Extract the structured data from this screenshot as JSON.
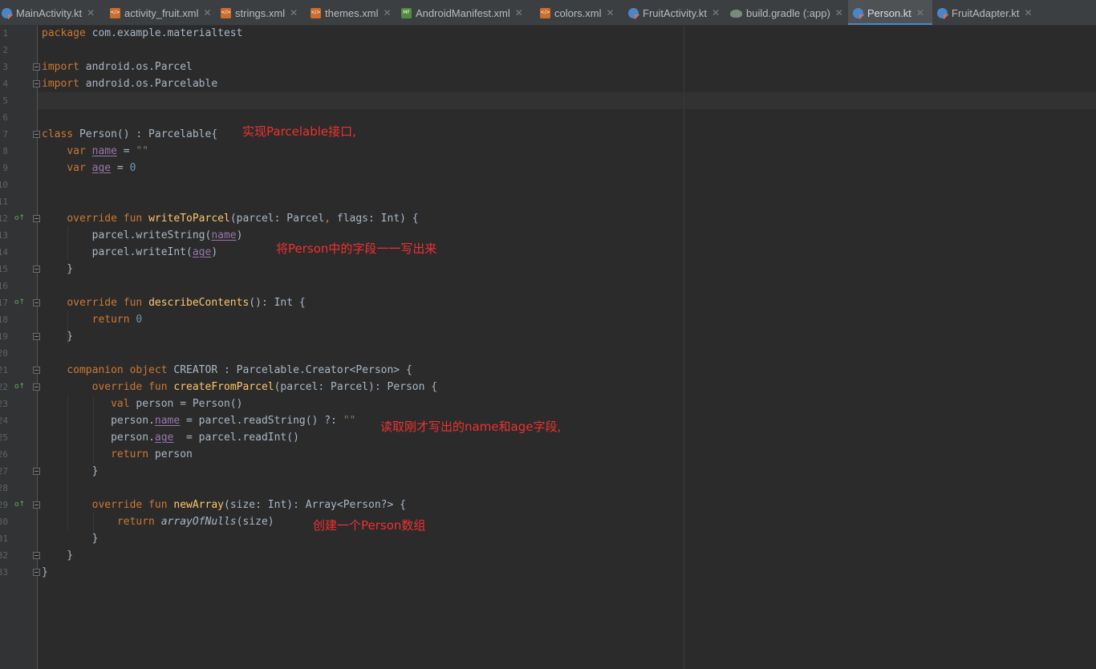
{
  "tabs": [
    {
      "label": "MainActivity.kt",
      "icon": "kotlin-file-icon",
      "active": false
    },
    {
      "label": "activity_fruit.xml",
      "icon": "xml-file-icon",
      "active": false
    },
    {
      "label": "strings.xml",
      "icon": "xml-file-icon",
      "active": false
    },
    {
      "label": "themes.xml",
      "icon": "xml-file-icon",
      "active": false
    },
    {
      "label": "AndroidManifest.xml",
      "icon": "manifest-file-icon",
      "active": false
    },
    {
      "label": "colors.xml",
      "icon": "xml-file-icon",
      "active": false
    },
    {
      "label": "FruitActivity.kt",
      "icon": "kotlin-file-icon",
      "active": false
    },
    {
      "label": "build.gradle (:app)",
      "icon": "gradle-file-icon",
      "active": false
    },
    {
      "label": "Person.kt",
      "icon": "kotlin-file-icon",
      "active": true
    },
    {
      "label": "FruitAdapter.kt",
      "icon": "kotlin-file-icon",
      "active": false
    }
  ],
  "tab_close_glyph": "✕",
  "gutter": {
    "line_numbers": [
      "1",
      "2",
      "3",
      "4",
      "5",
      "6",
      "7",
      "8",
      "9",
      "10",
      "11",
      "12",
      "13",
      "14",
      "15",
      "16",
      "17",
      "18",
      "19",
      "20",
      "21",
      "22",
      "23",
      "24",
      "25",
      "26",
      "27",
      "28",
      "29",
      "30",
      "31",
      "32",
      "33"
    ],
    "override_marker_lines": [
      12,
      17,
      22,
      29
    ],
    "override_glyph": "o↑",
    "override_icon": "override-method-icon",
    "fold_marker_lines": [
      3,
      4,
      7,
      12,
      15,
      17,
      19,
      21,
      22,
      27,
      29,
      32,
      33
    ]
  },
  "code": {
    "caret_line": 5,
    "lines": [
      {
        "n": 1,
        "tokens": [
          [
            "package",
            "kw"
          ],
          [
            " com.example.materialtest",
            ""
          ]
        ]
      },
      {
        "n": 2,
        "tokens": []
      },
      {
        "n": 3,
        "tokens": [
          [
            "import",
            "kw"
          ],
          [
            " android.os.Parcel",
            ""
          ]
        ]
      },
      {
        "n": 4,
        "tokens": [
          [
            "import",
            "kw"
          ],
          [
            " android.os.Parcelable",
            ""
          ]
        ]
      },
      {
        "n": 5,
        "tokens": []
      },
      {
        "n": 6,
        "tokens": []
      },
      {
        "n": 7,
        "tokens": [
          [
            "class",
            "kw"
          ],
          [
            " Person() : Parcelable{",
            ""
          ]
        ]
      },
      {
        "n": 8,
        "tokens": [
          [
            "    ",
            ""
          ],
          [
            "var",
            "kw"
          ],
          [
            " ",
            ""
          ],
          [
            "name",
            "prop"
          ],
          [
            " = ",
            ""
          ],
          [
            "\"\"",
            "str"
          ]
        ]
      },
      {
        "n": 9,
        "tokens": [
          [
            "    ",
            ""
          ],
          [
            "var",
            "kw"
          ],
          [
            " ",
            ""
          ],
          [
            "age",
            "prop"
          ],
          [
            " = ",
            ""
          ],
          [
            "0",
            "num"
          ]
        ]
      },
      {
        "n": 10,
        "tokens": []
      },
      {
        "n": 11,
        "tokens": []
      },
      {
        "n": 12,
        "tokens": [
          [
            "    ",
            ""
          ],
          [
            "override fun",
            "kw"
          ],
          [
            " ",
            ""
          ],
          [
            "writeToParcel",
            "fn"
          ],
          [
            "(parcel: Parcel",
            ""
          ],
          [
            ",",
            "kw"
          ],
          [
            " flags: Int) {",
            ""
          ]
        ]
      },
      {
        "n": 13,
        "tokens": [
          [
            "        parcel.writeString(",
            ""
          ],
          [
            "name",
            "prop"
          ],
          [
            ")",
            ""
          ]
        ]
      },
      {
        "n": 14,
        "tokens": [
          [
            "        parcel.writeInt(",
            ""
          ],
          [
            "age",
            "prop"
          ],
          [
            ")",
            ""
          ]
        ]
      },
      {
        "n": 15,
        "tokens": [
          [
            "    }",
            ""
          ]
        ]
      },
      {
        "n": 16,
        "tokens": []
      },
      {
        "n": 17,
        "tokens": [
          [
            "    ",
            ""
          ],
          [
            "override fun",
            "kw"
          ],
          [
            " ",
            ""
          ],
          [
            "describeContents",
            "fn"
          ],
          [
            "(): Int {",
            ""
          ]
        ]
      },
      {
        "n": 18,
        "tokens": [
          [
            "        ",
            ""
          ],
          [
            "return",
            "kw"
          ],
          [
            " ",
            ""
          ],
          [
            "0",
            "num"
          ]
        ]
      },
      {
        "n": 19,
        "tokens": [
          [
            "    }",
            ""
          ]
        ]
      },
      {
        "n": 20,
        "tokens": []
      },
      {
        "n": 21,
        "tokens": [
          [
            "    ",
            ""
          ],
          [
            "companion object",
            "kw"
          ],
          [
            " CREATOR : Parcelable.Creator<Person> {",
            ""
          ]
        ]
      },
      {
        "n": 22,
        "tokens": [
          [
            "        ",
            ""
          ],
          [
            "override fun",
            "kw"
          ],
          [
            " ",
            ""
          ],
          [
            "createFromParcel",
            "fn"
          ],
          [
            "(parcel: Parcel): Person {",
            ""
          ]
        ]
      },
      {
        "n": 23,
        "tokens": [
          [
            "           ",
            ""
          ],
          [
            "val",
            "kw"
          ],
          [
            " person = Person()",
            ""
          ]
        ]
      },
      {
        "n": 24,
        "tokens": [
          [
            "           person.",
            ""
          ],
          [
            "name",
            "prop"
          ],
          [
            " = parcel.readString() ?: ",
            ""
          ],
          [
            "\"\"",
            "str"
          ]
        ]
      },
      {
        "n": 25,
        "tokens": [
          [
            "           person.",
            ""
          ],
          [
            "age",
            "prop"
          ],
          [
            "  = parcel.readInt()",
            ""
          ]
        ]
      },
      {
        "n": 26,
        "tokens": [
          [
            "           ",
            ""
          ],
          [
            "return",
            "kw"
          ],
          [
            " person",
            ""
          ]
        ]
      },
      {
        "n": 27,
        "tokens": [
          [
            "        }",
            ""
          ]
        ]
      },
      {
        "n": 28,
        "tokens": []
      },
      {
        "n": 29,
        "tokens": [
          [
            "        ",
            ""
          ],
          [
            "override fun",
            "kw"
          ],
          [
            " ",
            ""
          ],
          [
            "newArray",
            "fn"
          ],
          [
            "(size: Int): Array<Person?> {",
            ""
          ]
        ]
      },
      {
        "n": 30,
        "tokens": [
          [
            "            ",
            ""
          ],
          [
            "return",
            "kw"
          ],
          [
            " ",
            ""
          ],
          [
            "arrayOfNulls",
            "ital"
          ],
          [
            "(size)",
            ""
          ]
        ]
      },
      {
        "n": 31,
        "tokens": [
          [
            "        }",
            ""
          ]
        ]
      },
      {
        "n": 32,
        "tokens": [
          [
            "    }",
            ""
          ]
        ]
      },
      {
        "n": 33,
        "tokens": [
          [
            "}",
            ""
          ]
        ]
      }
    ]
  },
  "annotations": [
    {
      "text": "实现Parcelable接口,",
      "name": "annotation-implement-parcelable"
    },
    {
      "text": "将Person中的字段一一写出来",
      "name": "annotation-write-fields"
    },
    {
      "text": "读取刚才写出的name和age字段,",
      "name": "annotation-read-fields"
    },
    {
      "text": "创建一个Person数组",
      "name": "annotation-create-array"
    }
  ],
  "colors": {
    "editor_background": "#2b2b2b",
    "gutter_background": "#313335",
    "tab_bar_background": "#3c3f41",
    "active_tab_underline": "#4a88c7",
    "keyword": "#cc7832",
    "function": "#ffc66d",
    "number": "#6897bb",
    "string": "#6a8759",
    "property": "#9876aa",
    "default_text": "#a9b7c6",
    "annotation_red": "#f03030"
  }
}
